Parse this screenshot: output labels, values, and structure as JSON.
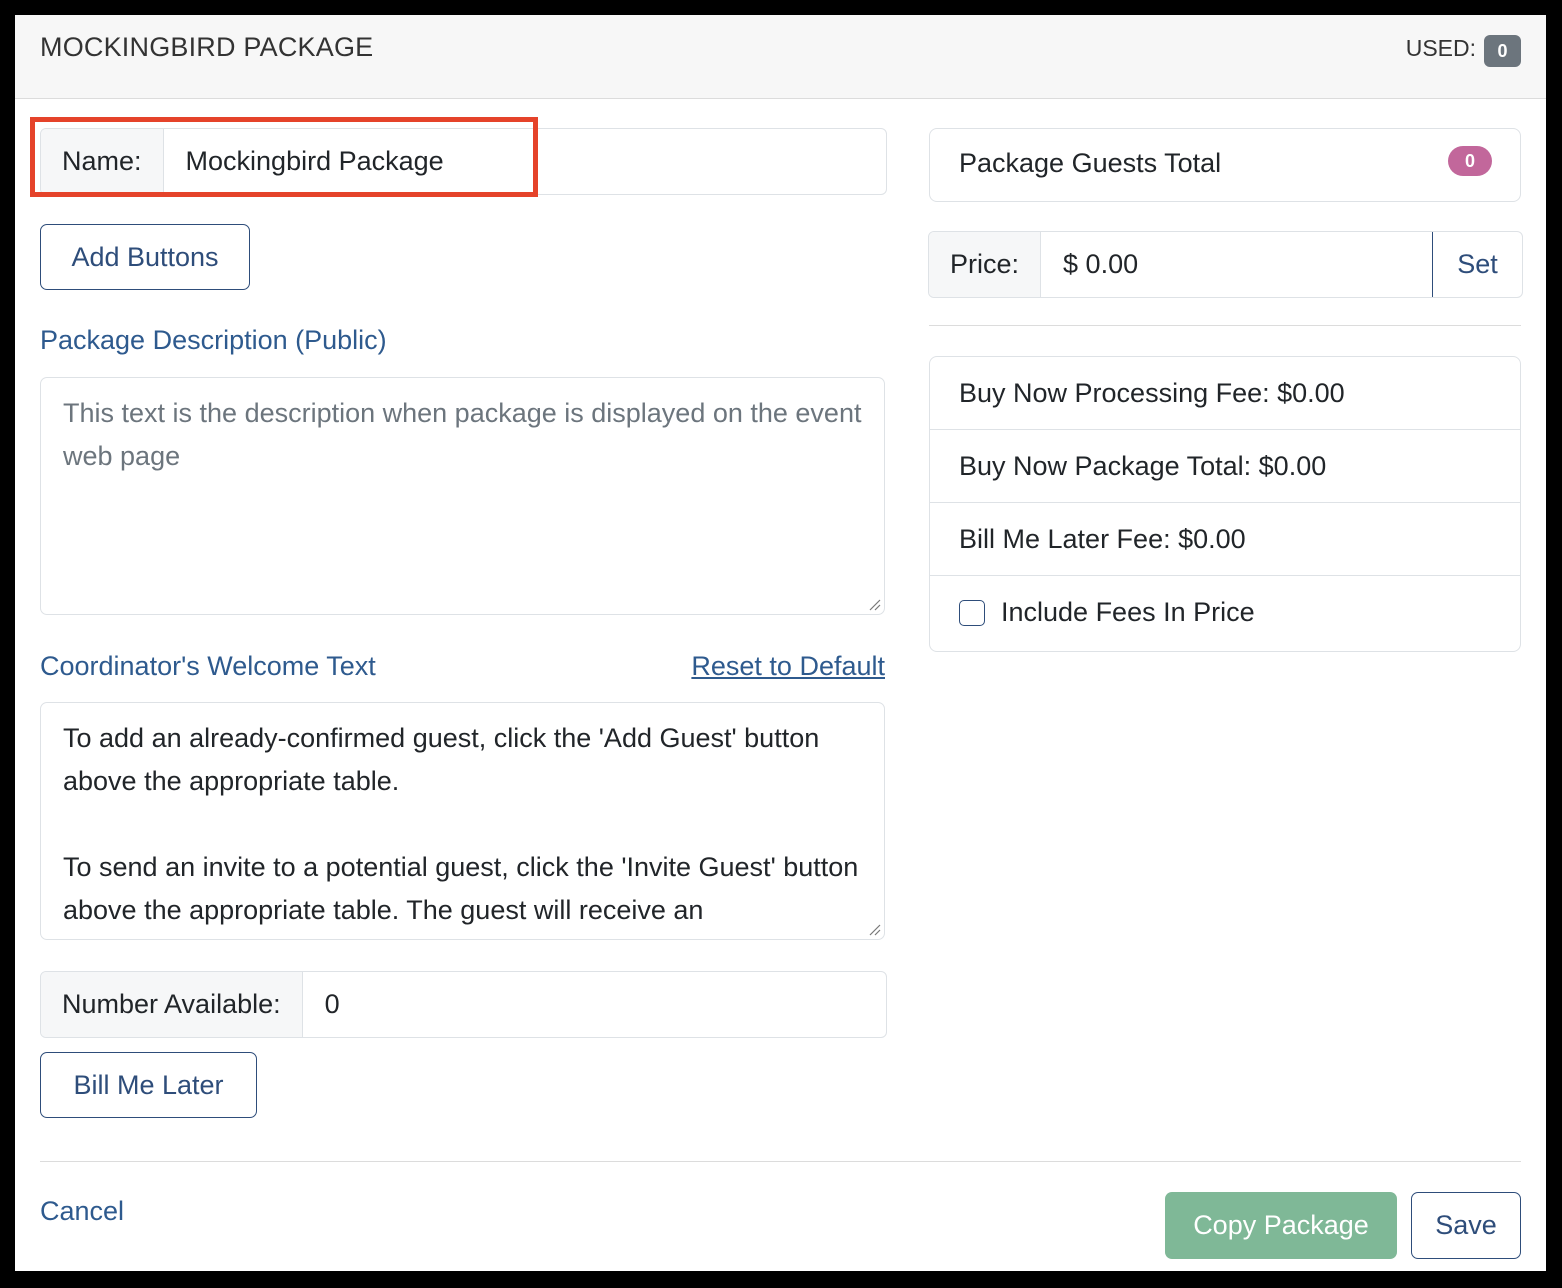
{
  "header": {
    "title": "MOCKINGBIRD PACKAGE",
    "used_label": "USED:",
    "used_count": "0"
  },
  "name_field": {
    "label": "Name:",
    "value": "Mockingbird Package"
  },
  "add_buttons_label": "Add Buttons",
  "description": {
    "label": "Package Description (Public)",
    "placeholder": "This text is the description when package is displayed on the event web page"
  },
  "welcome": {
    "label": "Coordinator's Welcome Text",
    "reset_link": "Reset to Default",
    "paragraph_1": "To add an already-confirmed guest, click the 'Add Guest' button above the appropriate table.",
    "paragraph_2": "To send an invite to a potential guest, click the 'Invite Guest' button above the appropriate table. The guest will receive an"
  },
  "number_available": {
    "label": "Number Available:",
    "value": "0"
  },
  "bill_me_later_label": "Bill Me Later",
  "guests_total": {
    "label": "Package Guests Total",
    "count": "0"
  },
  "price": {
    "label": "Price:",
    "value": "$ 0.00",
    "set_label": "Set"
  },
  "fees": {
    "processing_fee": "Buy Now Processing Fee: $0.00",
    "package_total": "Buy Now Package Total: $0.00",
    "bill_later_fee": "Bill Me Later Fee: $0.00",
    "include_fees_label": "Include Fees In Price",
    "include_fees_checked": false
  },
  "footer": {
    "cancel_label": "Cancel",
    "copy_label": "Copy Package",
    "save_label": "Save"
  },
  "colors": {
    "accent": "#2e4d7a",
    "highlight": "#e5432a",
    "copy_button": "#7fb897",
    "guests_badge": "#c2679b",
    "used_badge": "#6c757d"
  }
}
